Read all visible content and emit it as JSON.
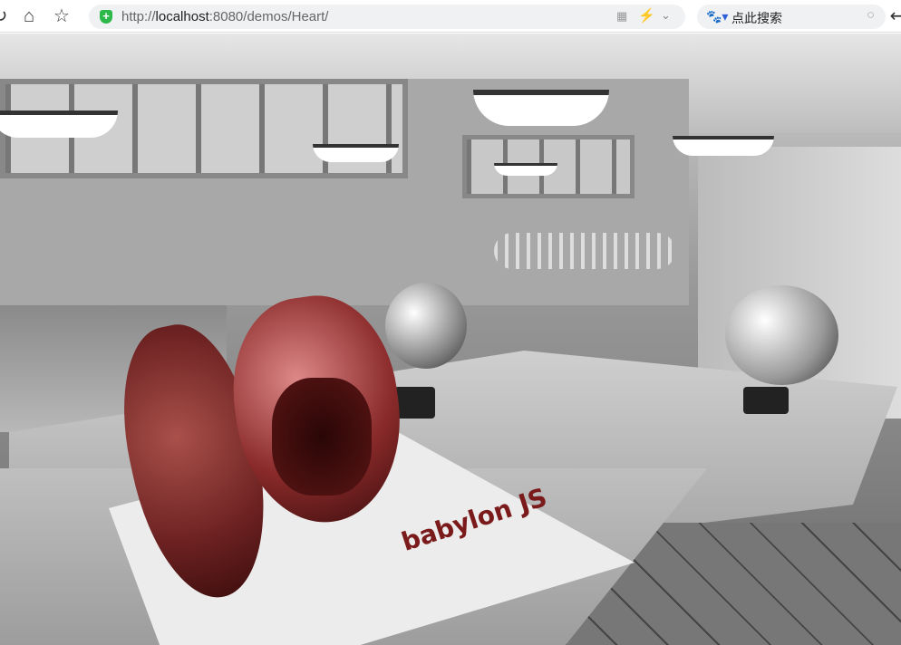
{
  "browser": {
    "url_scheme": "http://",
    "url_host": "localhost",
    "url_rest": ":8080/demos/Heart/",
    "search_placeholder": "点此搜索",
    "icons": [
      "reload-icon",
      "home-icon",
      "star-icon",
      "shield-icon",
      "qr-code-icon",
      "lightning-icon",
      "chevron-down-icon",
      "baidu-paw-icon",
      "search-icon",
      "back-icon"
    ]
  },
  "scene": {
    "description_logo": "babylon JS",
    "colors": {
      "heart": "#8a2a2a",
      "paper": "#e8e8e8",
      "floor": "#555555"
    }
  }
}
